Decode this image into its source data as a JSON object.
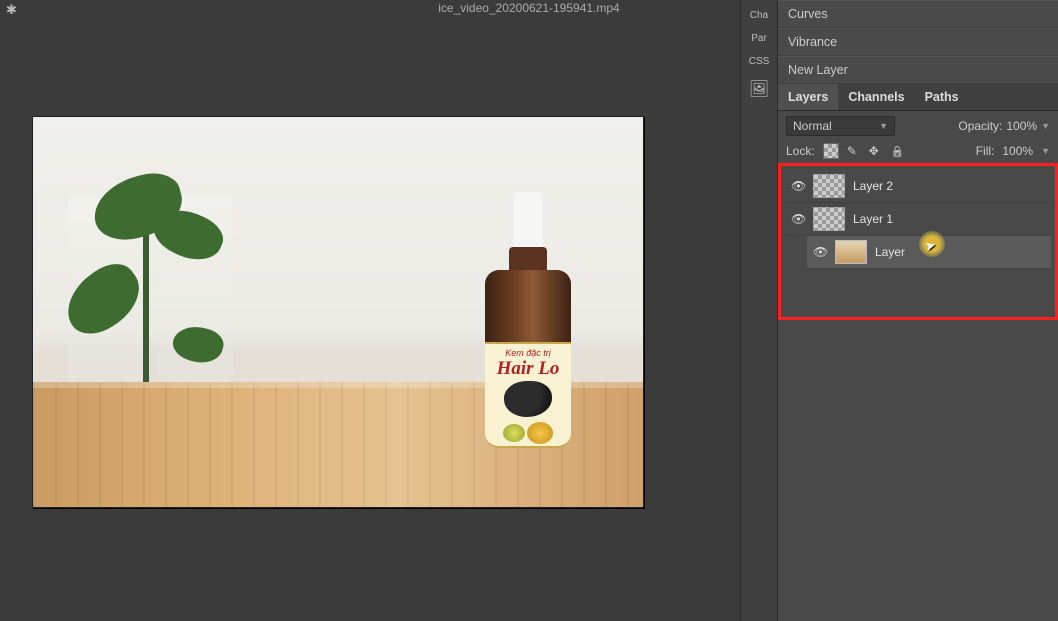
{
  "title": "ice_video_20200621-195941.mp4",
  "mini_tabs": {
    "cha": "Cha",
    "par": "Par",
    "css": "CSS"
  },
  "adjustments": {
    "curves": "Curves",
    "vibrance": "Vibrance",
    "newlayer": "New Layer"
  },
  "panel_tabs": {
    "layers": "Layers",
    "channels": "Channels",
    "paths": "Paths"
  },
  "blend_mode": "Normal",
  "opacity_label": "Opacity:",
  "opacity_value": "100%",
  "lock_label": "Lock:",
  "fill_label": "Fill:",
  "fill_value": "100%",
  "layers": {
    "l0": {
      "name": "Layer 2"
    },
    "l1": {
      "name": "Layer 1"
    },
    "l2": {
      "name": "Layer"
    }
  },
  "product": {
    "small": "Kem đặc trị",
    "big": "Hair Lo"
  }
}
